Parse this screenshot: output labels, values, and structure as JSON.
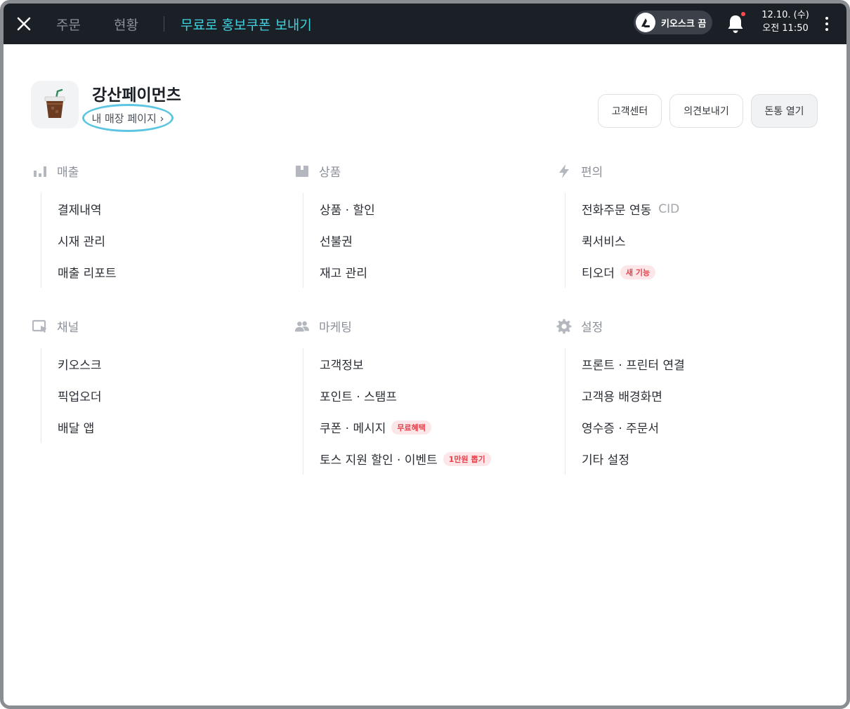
{
  "topbar": {
    "tabs": [
      {
        "label": "주문"
      },
      {
        "label": "현황"
      }
    ],
    "promo_label": "무료로 홍보쿠폰 보내기",
    "kiosk_label": "키오스크 끔",
    "date": "12.10. (수)",
    "time": "오전 11:50"
  },
  "store": {
    "name": "강산페이먼츠",
    "page_link": "내 매장 페이지 ›"
  },
  "header_buttons": {
    "support": "고객센터",
    "feedback": "의견보내기",
    "cash_drawer": "돈통 열기"
  },
  "sections": [
    {
      "title": "매출",
      "icon": "bar-chart-icon",
      "items": [
        {
          "label": "결제내역"
        },
        {
          "label": "시재 관리"
        },
        {
          "label": "매출 리포트"
        }
      ]
    },
    {
      "title": "상품",
      "icon": "box-icon",
      "items": [
        {
          "label": "상품 · 할인"
        },
        {
          "label": "선불권"
        },
        {
          "label": "재고 관리"
        }
      ]
    },
    {
      "title": "편의",
      "icon": "lightning-icon",
      "items": [
        {
          "label": "전화주문 연동",
          "suffix": "CID"
        },
        {
          "label": "퀵서비스"
        },
        {
          "label": "티오더",
          "badge": "새 기능"
        }
      ]
    },
    {
      "title": "채널",
      "icon": "channel-icon",
      "items": [
        {
          "label": "키오스크"
        },
        {
          "label": "픽업오더"
        },
        {
          "label": "배달 앱"
        }
      ]
    },
    {
      "title": "마케팅",
      "icon": "people-icon",
      "items": [
        {
          "label": "고객정보"
        },
        {
          "label": "포인트 · 스탬프"
        },
        {
          "label": "쿠폰 · 메시지",
          "badge": "무료혜택"
        },
        {
          "label": "토스 지원 할인 · 이벤트",
          "badge": "1만원 뽑기"
        }
      ]
    },
    {
      "title": "설정",
      "icon": "gear-icon",
      "items": [
        {
          "label": "프론트 · 프린터 연결"
        },
        {
          "label": "고객용 배경화면"
        },
        {
          "label": "영수증 · 주문서"
        },
        {
          "label": "기타 설정"
        }
      ]
    }
  ],
  "colors": {
    "topbar_bg": "#1b1f26",
    "accent_cyan": "#3fd3e0",
    "badge_red": "#e3424d",
    "badge_bg": "#fde6e7",
    "highlight_ring": "#5cc6e2"
  }
}
